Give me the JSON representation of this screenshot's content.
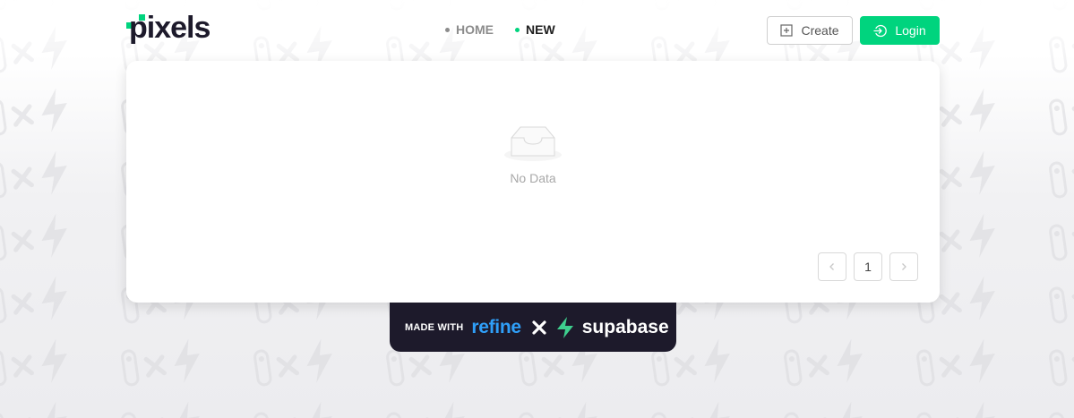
{
  "logo": {
    "text": "pixels",
    "accent": "#00d47e",
    "dark": "#1d1a2b"
  },
  "nav": {
    "items": [
      {
        "label": "HOME",
        "active": false
      },
      {
        "label": "NEW",
        "active": true
      }
    ]
  },
  "actions": {
    "create_label": "Create",
    "create_icon": "plus-square-icon",
    "login_label": "Login",
    "login_icon": "login-icon"
  },
  "content": {
    "empty_text": "No Data",
    "empty_icon": "inbox-icon"
  },
  "pagination": {
    "current_page": "1",
    "prev_icon": "chevron-left-icon",
    "next_icon": "chevron-right-icon"
  },
  "footer": {
    "made_with": "MADE WITH",
    "refine": "refine",
    "supabase": "supabase"
  },
  "colors": {
    "accent": "#00d47e",
    "badge_bg": "#1d1a2b",
    "refine_blue": "#2f9ff8",
    "supabase_green": "#3ecf8e"
  }
}
